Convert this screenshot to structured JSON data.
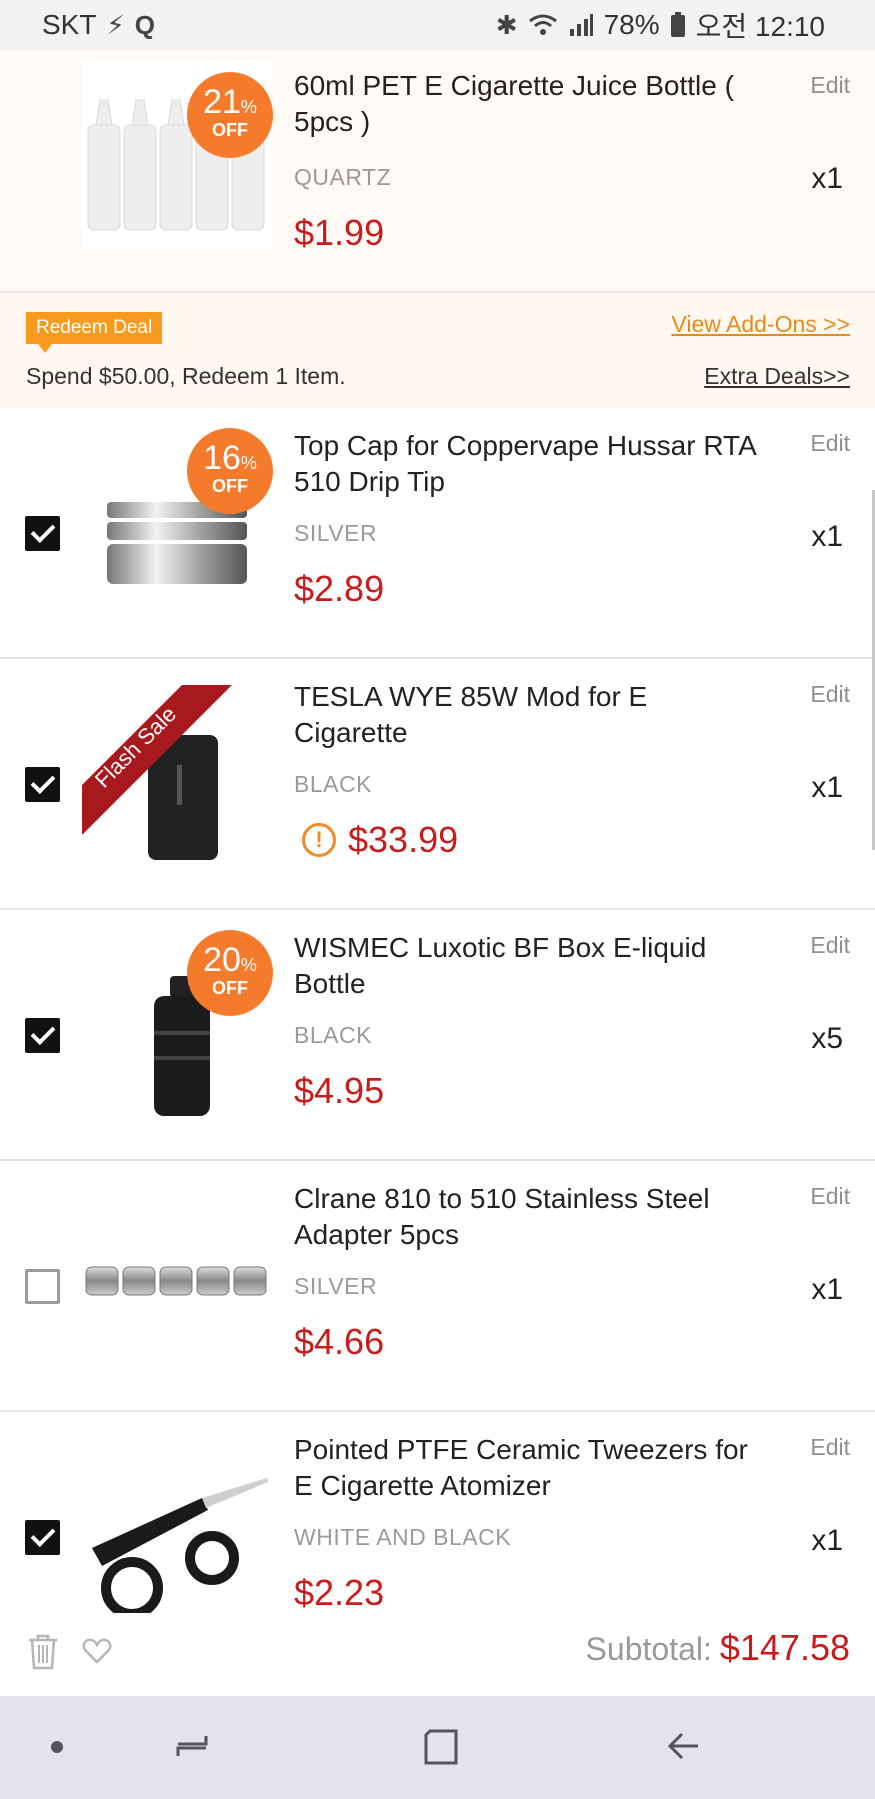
{
  "status_bar": {
    "carrier": "SKT",
    "battery": "78%",
    "time": "오전 12:10"
  },
  "items": [
    {
      "title": "60ml PET E Cigarette Juice Bottle ( 5pcs )",
      "variant": "QUARTZ",
      "price": "$1.99",
      "qty": "x1",
      "edit": "Edit",
      "discount_num": "21",
      "discount_pct": "%",
      "discount_off": "OFF"
    },
    {
      "title": "Top Cap for Coppervape Hussar RTA 510 Drip Tip",
      "variant": "SILVER",
      "price": "$2.89",
      "qty": "x1",
      "edit": "Edit",
      "checked": true,
      "discount_num": "16",
      "discount_pct": "%",
      "discount_off": "OFF"
    },
    {
      "title": "TESLA WYE 85W Mod for E Cigarette",
      "variant": "BLACK",
      "price": "$33.99",
      "qty": "x1",
      "edit": "Edit",
      "checked": true,
      "ribbon": "Flash Sale",
      "warn": "!"
    },
    {
      "title": "WISMEC Luxotic BF Box E-liquid Bottle",
      "variant": "BLACK",
      "price": "$4.95",
      "qty": "x5",
      "edit": "Edit",
      "checked": true,
      "discount_num": "20",
      "discount_pct": "%",
      "discount_off": "OFF"
    },
    {
      "title": "Clrane 810 to 510 Stainless Steel Adapter 5pcs",
      "variant": "SILVER",
      "price": "$4.66",
      "qty": "x1",
      "edit": "Edit",
      "checked": false
    },
    {
      "title": "Pointed PTFE Ceramic Tweezers for E Cigarette Atomizer",
      "variant": "WHITE AND BLACK",
      "price": "$2.23",
      "qty": "x1",
      "edit": "Edit",
      "checked": true
    }
  ],
  "deal": {
    "badge": "Redeem Deal",
    "text": "Spend $50.00, Redeem 1 Item.",
    "addons_link": "View Add-Ons >>",
    "extra_link": "Extra Deals>>"
  },
  "footer": {
    "subtotal_label": "Subtotal:",
    "subtotal_value": "$147.58"
  },
  "colors": {
    "price": "#c81c1c",
    "discount_badge": "#f47a2c",
    "deal_badge": "#f79a1e",
    "link_orange": "#e88a1a"
  },
  "icons": [
    "bluetooth-icon",
    "wifi-icon",
    "signal-icon",
    "battery-icon",
    "trash-icon",
    "heart-icon",
    "warning-icon",
    "nav-recent-icon",
    "nav-home-icon",
    "nav-back-icon"
  ]
}
